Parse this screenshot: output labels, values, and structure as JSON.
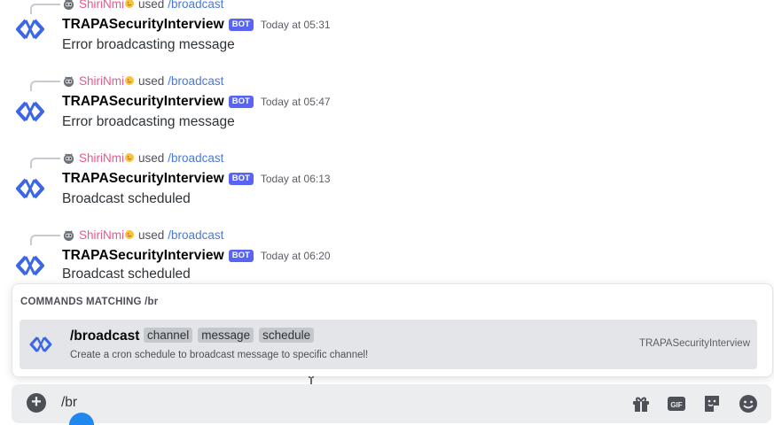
{
  "messages": [
    {
      "reply_user": "ShiriNmi",
      "reply_used": "used",
      "reply_command": "/broadcast",
      "username": "TRAPASecurityInterview",
      "badge": "BOT",
      "timestamp": "Today at 05:31",
      "content": "Error broadcasting message"
    },
    {
      "reply_user": "ShiriNmi",
      "reply_used": "used",
      "reply_command": "/broadcast",
      "username": "TRAPASecurityInterview",
      "badge": "BOT",
      "timestamp": "Today at 05:47",
      "content": "Error broadcasting message"
    },
    {
      "reply_user": "ShiriNmi",
      "reply_used": "used",
      "reply_command": "/broadcast",
      "username": "TRAPASecurityInterview",
      "badge": "BOT",
      "timestamp": "Today at 06:13",
      "content": "Broadcast scheduled"
    },
    {
      "reply_user": "ShiriNmi",
      "reply_used": "used",
      "reply_command": "/broadcast",
      "username": "TRAPASecurityInterview",
      "badge": "BOT",
      "timestamp": "Today at 06:20",
      "content": "Broadcast scheduled"
    }
  ],
  "autocomplete": {
    "header": "COMMANDS MATCHING /br",
    "command": {
      "name": "/broadcast",
      "options": [
        "channel",
        "message",
        "schedule"
      ],
      "description": "Create a cron schedule to broadcast message to specific channel!",
      "app": "TRAPASecurityInterview"
    }
  },
  "composer": {
    "value": "/br"
  },
  "colors": {
    "bot_badge": "#5865f2",
    "reply_user": "#e8588e",
    "command_link": "#4a78d6",
    "logo": "#3b66e6"
  },
  "icons": {
    "avatar": "trapa-logo-icon",
    "mini_avatar": "robot-avatar-icon",
    "emoji": "sun-emoji-icon",
    "composer": [
      "plus-icon",
      "gift-icon",
      "gif-icon",
      "sticker-icon",
      "emoji-icon"
    ]
  }
}
